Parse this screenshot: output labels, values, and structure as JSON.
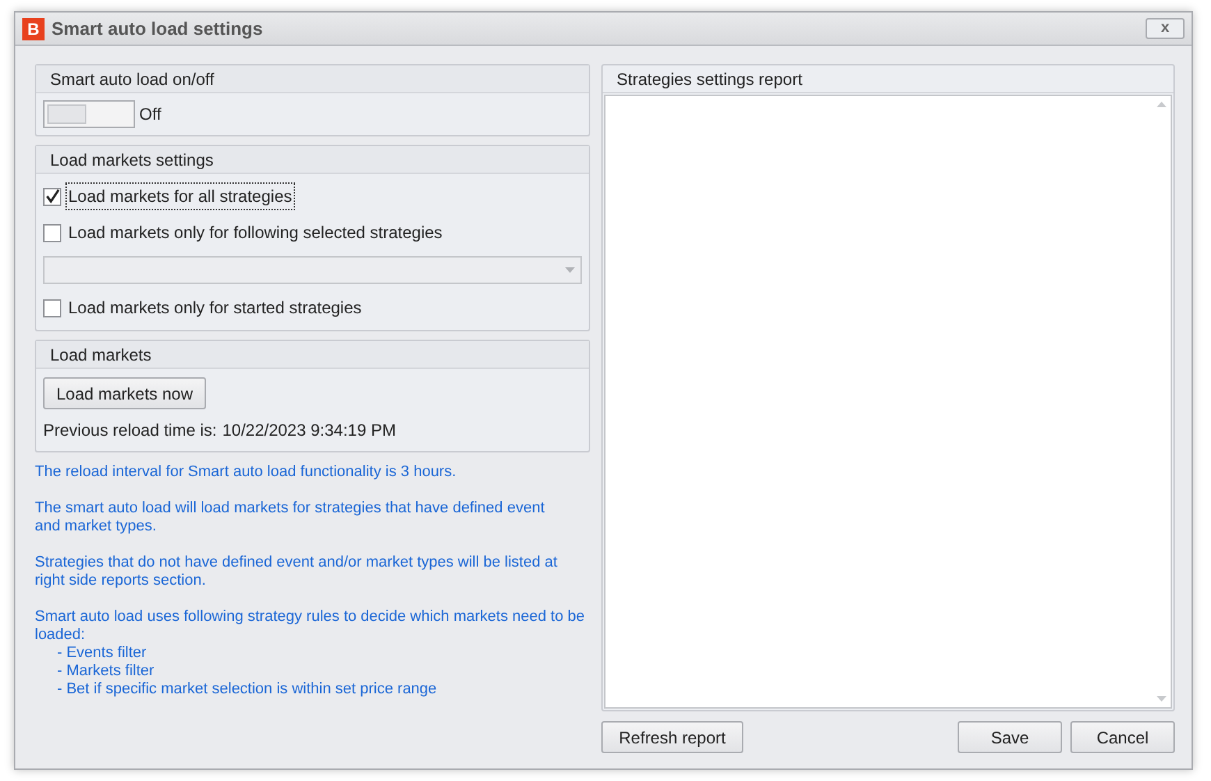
{
  "window": {
    "title": "Smart auto load settings",
    "logo": "B",
    "close": "x"
  },
  "auto_load": {
    "title": "Smart auto load on/off",
    "on": false,
    "state_label": "Off"
  },
  "load_markets_settings": {
    "title": "Load markets settings",
    "items": [
      {
        "kind": "checkbox",
        "label": "Load markets for all strategies",
        "checked": true,
        "focused": true
      },
      {
        "kind": "checkbox",
        "label": "Load markets only for following selected strategies",
        "checked": false,
        "focused": false
      },
      {
        "kind": "dropdown"
      },
      {
        "kind": "checkbox",
        "label": "Load markets only for started strategies",
        "checked": false,
        "focused": false
      }
    ]
  },
  "load_markets": {
    "title": "Load markets",
    "button": "Load markets now",
    "reload_label": "Previous reload time is:",
    "reload_time": "10/22/2023 9:34:19 PM"
  },
  "info": {
    "paragraphs": [
      "The reload interval for Smart auto load functionality is 3 hours.",
      "The smart auto load will load markets for strategies that have defined event\nand market types.",
      "Strategies that do not have defined event and/or market types will be listed at\nright side reports section.",
      "Smart auto load uses following strategy rules to decide which markets need to be\nloaded:"
    ],
    "rules": [
      "- Events filter",
      "- Markets filter",
      "- Bet if specific market selection is within set price range"
    ]
  },
  "report": {
    "title": "Strategies settings report"
  },
  "buttons": {
    "refresh": "Refresh report",
    "save": "Save",
    "cancel": "Cancel"
  }
}
